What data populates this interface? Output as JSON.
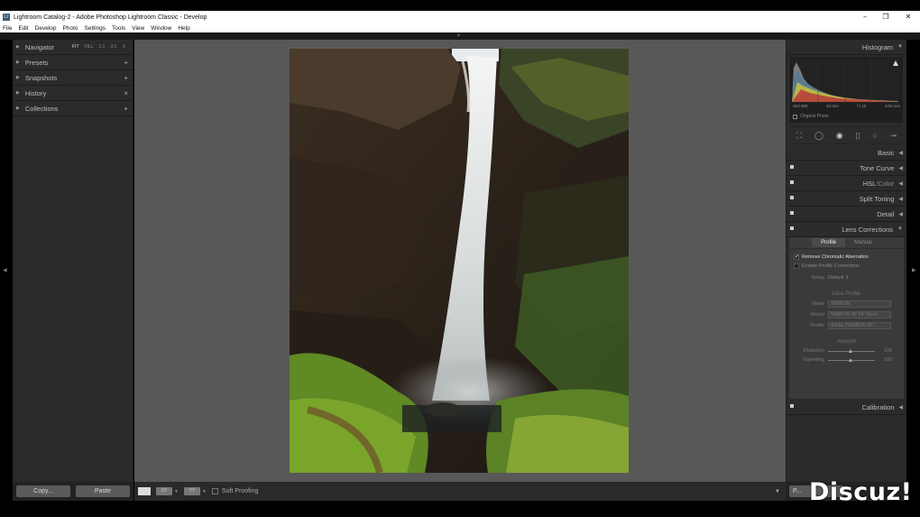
{
  "window": {
    "title": "Lightroom Catalog-2 - Adobe Photoshop Lightroom Classic - Develop",
    "icon": "Lr",
    "minimize": "–",
    "maximize": "❐",
    "close": "✕"
  },
  "menu": [
    "File",
    "Edit",
    "Develop",
    "Photo",
    "Settings",
    "Tools",
    "View",
    "Window",
    "Help"
  ],
  "left_panel": {
    "navigator": {
      "label": "Navigator",
      "zoom": [
        "FIT",
        "FILL",
        "1:1",
        "3:1"
      ],
      "zoom_chevron": "⇕"
    },
    "items": [
      {
        "label": "Presets",
        "action": "+"
      },
      {
        "label": "Snapshots",
        "action": "+"
      },
      {
        "label": "History",
        "action": "×"
      },
      {
        "label": "Collections",
        "action": "+"
      }
    ],
    "copy_button": "Copy...",
    "paste_button": "Paste"
  },
  "toolbar": {
    "soft_proofing": "Soft Proofing",
    "compare_a": "XY",
    "compare_b": "YY"
  },
  "right_panel": {
    "histogram": {
      "label": "Histogram",
      "iso": "ISO 800",
      "focal": "42 mm",
      "aperture": "f / 10",
      "shutter": "1/15 sec",
      "original_photo": "Original Photo"
    },
    "sections": {
      "basic": "Basic",
      "tone_curve": "Tone Curve",
      "hsl": "HSL",
      "hsl_sep": " / ",
      "color": "Color",
      "split_toning": "Split Toning",
      "detail": "Detail",
      "lens_corrections": "Lens Corrections",
      "calibration": "Calibration"
    },
    "lens": {
      "tab_profile": "Profile",
      "tab_manual": "Manual",
      "remove_ca": "Remove Chromatic Aberration",
      "enable_profile": "Enable Profile Corrections",
      "setup_label": "Setup",
      "setup_value": "Default ⇕",
      "lens_profile_title": "Lens Profile",
      "make_label": "Make",
      "make_value": "TAMRON",
      "model_label": "Model",
      "model_value": "TAMRON SP 24-70mm",
      "profile_label": "Profile",
      "profile_value": "Adobe (TAMRON SP...",
      "amount_title": "Amount",
      "distortion_label": "Distortion",
      "distortion_value": "100",
      "vignetting_label": "Vignetting",
      "vignetting_value": "100"
    },
    "previous_button": "P..."
  },
  "watermark": "Discuz!"
}
